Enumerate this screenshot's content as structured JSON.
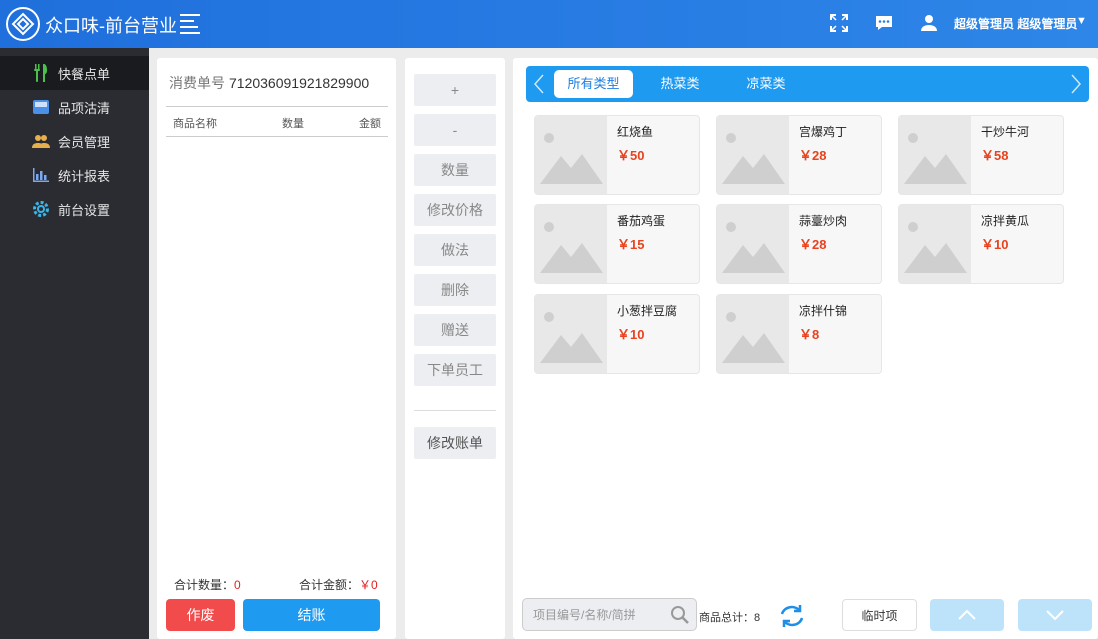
{
  "header": {
    "app_title": "众口味-前台营业",
    "user_name": "超级管理员 超级管理员",
    "icons": [
      "fullscreen-icon",
      "message-icon",
      "user-icon"
    ],
    "accent_color": "#2a7fe6"
  },
  "sidebar": {
    "items": [
      {
        "label": "快餐点单",
        "icon": "fork-knife-icon",
        "active": true
      },
      {
        "label": "品项沽清",
        "icon": "inbox-icon",
        "active": false
      },
      {
        "label": "会员管理",
        "icon": "members-icon",
        "active": false
      },
      {
        "label": "统计报表",
        "icon": "bar-chart-icon",
        "active": false
      },
      {
        "label": "前台设置",
        "icon": "gear-icon",
        "active": false
      }
    ]
  },
  "order": {
    "order_no_label": "消费单号",
    "order_no": "712036091921829900",
    "columns": [
      "商品名称",
      "数量",
      "金额"
    ],
    "total_qty_label": "合计数量：",
    "total_qty": "0",
    "total_amount_label": "合计金额：",
    "total_amount": "￥0",
    "void_label": "作废",
    "checkout_label": "结账"
  },
  "actions": {
    "items": [
      "+",
      "-",
      "数量",
      "修改价格",
      "做法",
      "删除",
      "赠送",
      "下单员工"
    ],
    "modify_bill": "修改账单"
  },
  "menu": {
    "categories": [
      {
        "label": "所有类型",
        "active": true
      },
      {
        "label": "热菜类",
        "active": false
      },
      {
        "label": "凉菜类",
        "active": false
      }
    ],
    "dishes": [
      {
        "name": "红烧鱼",
        "price": "￥50"
      },
      {
        "name": "宫爆鸡丁",
        "price": "￥28"
      },
      {
        "name": "干炒牛河",
        "price": "￥58"
      },
      {
        "name": "番茄鸡蛋",
        "price": "￥15"
      },
      {
        "name": "蒜薹炒肉",
        "price": "￥28"
      },
      {
        "name": "凉拌黄瓜",
        "price": "￥10"
      },
      {
        "name": "小葱拌豆腐",
        "price": "￥10"
      },
      {
        "name": "凉拌什锦",
        "price": "￥8"
      }
    ],
    "search_placeholder": "项目编号/名称/简拼",
    "total_label": "商品总计：8",
    "temp_item_label": "临时项"
  }
}
